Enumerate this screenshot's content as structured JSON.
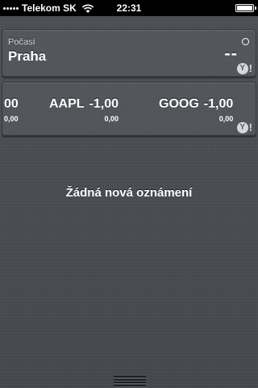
{
  "status_bar": {
    "carrier": "Telekom SK",
    "time": "22:31",
    "battery_level": 1.0
  },
  "weather": {
    "label": "Počasí",
    "city": "Praha",
    "temperature": "--",
    "degree_icon": "degree-circle",
    "provider_icon": "yahoo-logo"
  },
  "stocks": {
    "items": [
      {
        "symbol": "",
        "price": "00",
        "change": "0,00"
      },
      {
        "symbol": "AAPL",
        "price": "-1,00",
        "change": "0,00"
      },
      {
        "symbol": "GOOG",
        "price": "-1,00",
        "change": "0,00"
      }
    ],
    "provider_icon": "yahoo-logo"
  },
  "notifications": {
    "empty_message": "Žádná nová oznámení"
  },
  "icons": {
    "signal": "signal-dots-icon",
    "wifi": "wifi-icon",
    "battery": "battery-icon",
    "grabber": "grabber-handle-icon"
  }
}
